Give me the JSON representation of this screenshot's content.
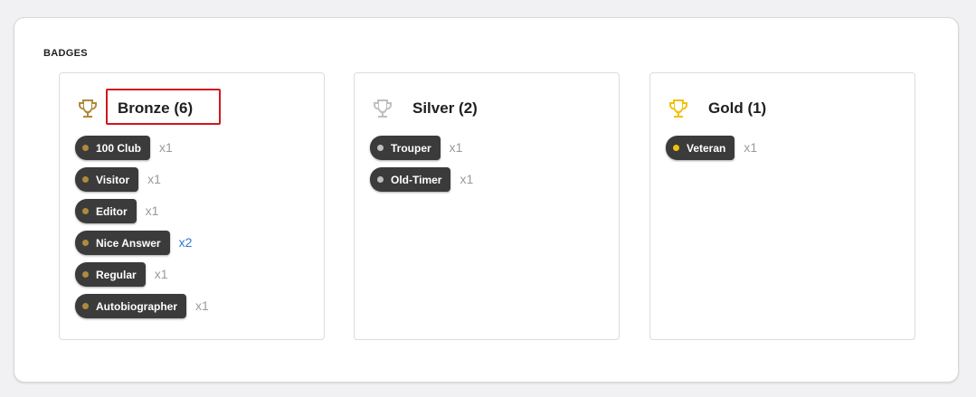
{
  "section_title": "BADGES",
  "colors": {
    "bronze": "#b08a3b",
    "silver": "#bfbfbf",
    "gold": "#f2c10d",
    "highlight": "#d0171d",
    "link": "#2c78d4"
  },
  "panels": [
    {
      "tier": "bronze",
      "icon": "trophy-icon",
      "title": "Bronze (6)",
      "badges": [
        {
          "label": "100 Club",
          "count": "x1"
        },
        {
          "label": "Visitor",
          "count": "x1"
        },
        {
          "label": "Editor",
          "count": "x1"
        },
        {
          "label": "Nice Answer",
          "count": "x2"
        },
        {
          "label": "Regular",
          "count": "x1"
        },
        {
          "label": "Autobiographer",
          "count": "x1"
        }
      ]
    },
    {
      "tier": "silver",
      "icon": "trophy-icon",
      "title": "Silver (2)",
      "badges": [
        {
          "label": "Trouper",
          "count": "x1"
        },
        {
          "label": "Old-Timer",
          "count": "x1"
        }
      ]
    },
    {
      "tier": "gold",
      "icon": "trophy-icon",
      "title": "Gold (1)",
      "badges": [
        {
          "label": "Veteran",
          "count": "x1"
        }
      ]
    }
  ]
}
